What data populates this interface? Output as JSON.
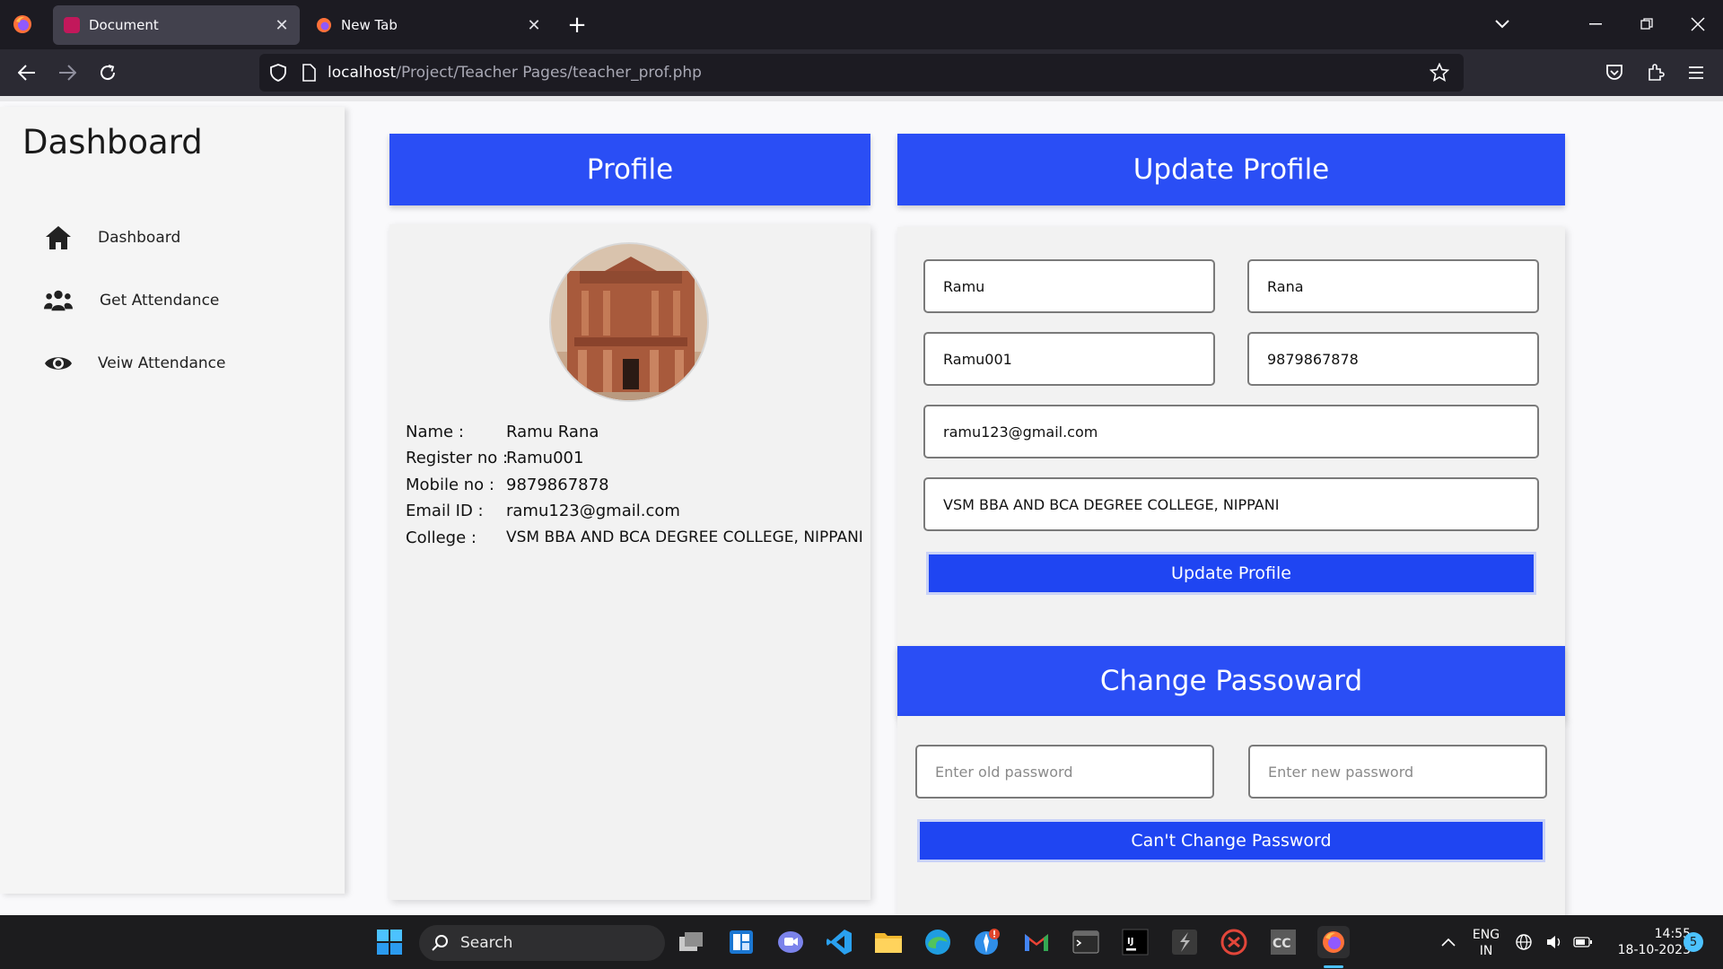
{
  "browser": {
    "tabs": [
      {
        "title": "Document",
        "active": true
      },
      {
        "title": "New Tab",
        "active": false
      }
    ],
    "url_host": "localhost",
    "url_path": "/Project/Teacher Pages/teacher_prof.php"
  },
  "sidebar": {
    "title": "Dashboard",
    "items": [
      {
        "label": "Dashboard",
        "icon": "home-icon"
      },
      {
        "label": "Get Attendance",
        "icon": "users-icon"
      },
      {
        "label": "Veiw Attendance",
        "icon": "eye-icon"
      }
    ]
  },
  "profile": {
    "heading": "Profile",
    "rows": [
      {
        "key": "Name :",
        "value": "Ramu Rana"
      },
      {
        "key": "Register no :",
        "value": "Ramu001"
      },
      {
        "key": "Mobile no :",
        "value": "9879867878"
      },
      {
        "key": "Email ID :",
        "value": "ramu123@gmail.com"
      },
      {
        "key": "College :",
        "value": "VSM BBA AND BCA DEGREE COLLEGE, NIPPANI"
      }
    ]
  },
  "update_profile": {
    "heading": "Update Profile",
    "first_name": "Ramu",
    "last_name": "Rana",
    "register_no": "Ramu001",
    "mobile": "9879867878",
    "email": "ramu123@gmail.com",
    "college": "VSM BBA AND BCA DEGREE COLLEGE, NIPPANI",
    "button": "Update Profile"
  },
  "change_password": {
    "heading": "Change Passoward",
    "old_placeholder": "Enter old password",
    "new_placeholder": "Enter new password",
    "button": "Can't Change Password"
  },
  "taskbar": {
    "search_label": "Search",
    "lang_top": "ENG",
    "lang_bottom": "IN",
    "time": "14:55",
    "date": "18-10-2023",
    "notification_count": "5"
  },
  "colors": {
    "accent": "#2a4ef5",
    "button": "#1f45f2",
    "browser_dark": "#1c1b22"
  }
}
